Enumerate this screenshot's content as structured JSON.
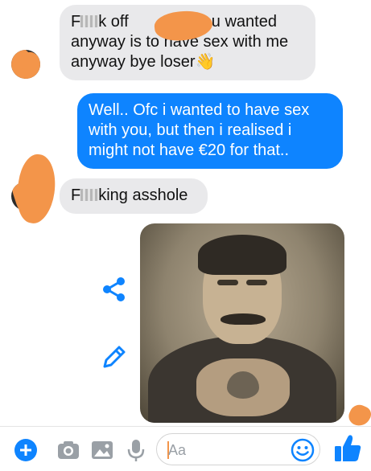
{
  "messages": [
    {
      "id": "m1",
      "sender": "other",
      "parts": [
        "F",
        "k off ",
        "ll you wanted anyway is to have sex with me anyway bye loser",
        "👋"
      ]
    },
    {
      "id": "m2",
      "sender": "me",
      "text": "Well.. Ofc i wanted to have sex with you, but then i realised i might not have €20 for that.."
    },
    {
      "id": "m3",
      "sender": "other",
      "parts": [
        "F",
        "king asshole"
      ]
    }
  ],
  "composer": {
    "placeholder": "Aa"
  },
  "icons": {
    "add": "plus-circle-icon",
    "camera": "camera-icon",
    "gallery": "image-icon",
    "mic": "microphone-icon",
    "emoji": "smiley-icon",
    "like": "thumbs-up-icon",
    "share": "share-icon",
    "edit": "pencil-icon"
  },
  "colors": {
    "accent": "#0e84ff",
    "incoming_bubble": "#e9e9eb",
    "redaction": "#f3954a"
  }
}
